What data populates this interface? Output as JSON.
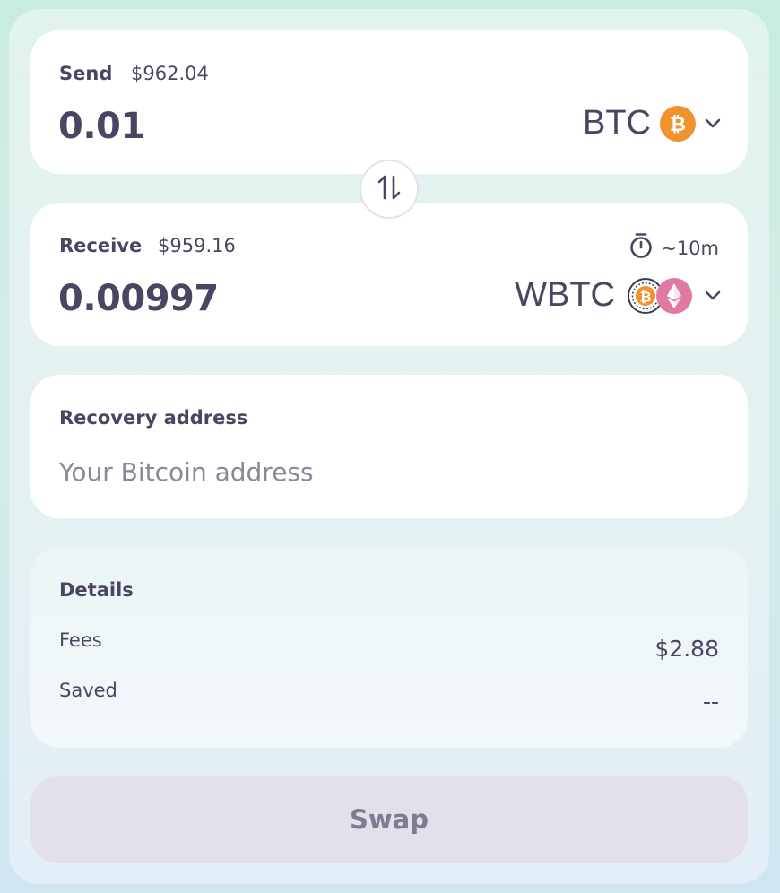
{
  "send": {
    "label": "Send",
    "usd_value": "$962.04",
    "amount": "0.01",
    "token": "BTC",
    "token_icon": "bitcoin-icon"
  },
  "receive": {
    "label": "Receive",
    "usd_value": "$959.16",
    "amount": "0.00997",
    "token": "WBTC",
    "token_icons": [
      "bitcoin-icon",
      "ethereum-icon"
    ],
    "eta": "~10m"
  },
  "recovery": {
    "label": "Recovery address",
    "placeholder": "Your Bitcoin address",
    "value": ""
  },
  "details": {
    "title": "Details",
    "fees_label": "Fees",
    "fees_value": "$2.88",
    "saved_label": "Saved",
    "saved_value": "--"
  },
  "swap_button": {
    "label": "Swap"
  },
  "colors": {
    "text": "#4a4563",
    "btc_orange": "#f0922e",
    "eth_pink": "#e07aa2",
    "button_disabled_bg": "#e3e0ea",
    "button_disabled_text": "#807b90"
  }
}
